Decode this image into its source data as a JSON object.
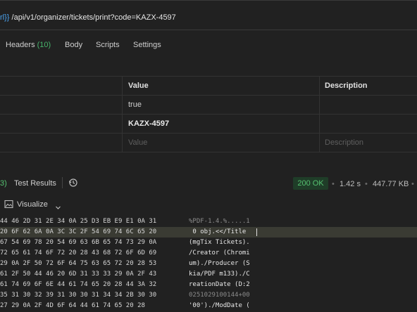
{
  "url": {
    "var_fragment": "rl}}",
    "path": " /api/v1/organizer/tickets/print?code=KAZX-4597"
  },
  "tabs": {
    "headers_label": "Headers",
    "headers_count": "(10)",
    "body": "Body",
    "scripts": "Scripts",
    "settings": "Settings"
  },
  "table": {
    "col_value": "Value",
    "col_description": "Description",
    "rows": [
      {
        "value": "true"
      },
      {
        "value": "KAZX-4597"
      }
    ],
    "placeholder_value": "Value",
    "placeholder_description": "Description"
  },
  "response": {
    "cookies_fragment": "3)",
    "test_results": "Test Results",
    "status": "200 OK",
    "time": "1.42 s",
    "size": "447.77 KB",
    "view_label": "Visualize",
    "colors": {
      "ok_bg": "#1f3d28",
      "ok_text": "#56c271",
      "link": "#4aa3f0"
    }
  },
  "hex_rows": [
    {
      "hex": "44 46 2D 31 2E 34 0A 25 D3 EB E9 E1 0A 31",
      "ascii": "%PDF-1.4.%.....1"
    },
    {
      "hex": "20 6F 62 6A 0A 3C 3C 2F 54 69 74 6C 65 20",
      "ascii": " 0 obj.<</Title "
    },
    {
      "hex": "67 54 69 78 20 54 69 63 6B 65 74 73 29 0A",
      "ascii": "(mgTix Tickets)."
    },
    {
      "hex": "72 65 61 74 6F 72 20 28 43 68 72 6F 6D 69",
      "ascii": "/Creator (Chromi"
    },
    {
      "hex": "29 0A 2F 50 72 6F 64 75 63 65 72 20 28 53",
      "ascii": "um)./Producer (S"
    },
    {
      "hex": "61 2F 50 44 46 20 6D 31 33 33 29 0A 2F 43",
      "ascii": "kia/PDF m133)./C"
    },
    {
      "hex": "61 74 69 6F 6E 44 61 74 65 20 28 44 3A 32",
      "ascii": "reationDate (D:2"
    },
    {
      "hex": "35 31 30 32 39 31 30 30 31 34 34 2B 30 30",
      "ascii": "0251029100144+00"
    },
    {
      "hex": "27 29 0A 2F 4D 6F 64 44 61 74 65 20 28",
      "ascii": "'00')./ModDate ("
    }
  ]
}
